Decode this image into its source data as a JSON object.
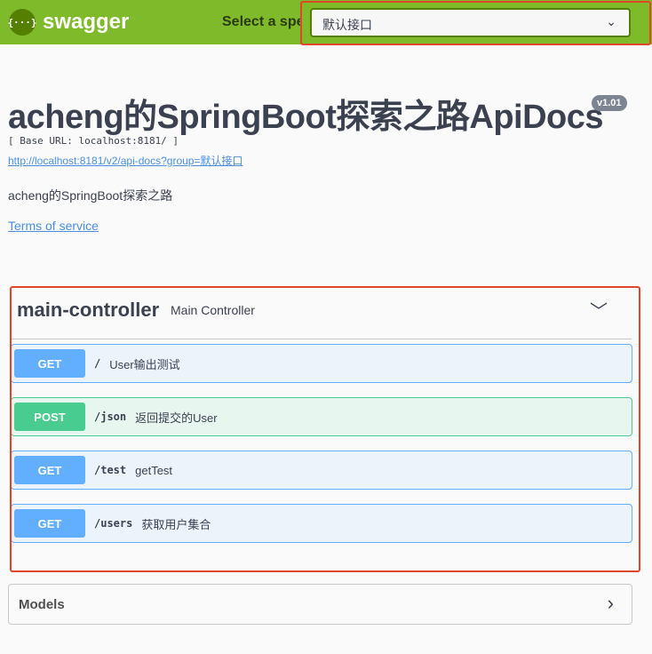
{
  "topbar": {
    "logo_glyph": "{···}",
    "brand": "swagger",
    "spec_label": "Select a spec",
    "spec_value": "默认接口"
  },
  "info": {
    "title": "acheng的SpringBoot探索之路ApiDocs",
    "version": "v1.01",
    "base_url": "[ Base URL: localhost:8181/ ]",
    "docs_link": "http://localhost:8181/v2/api-docs?group=默认接口",
    "description": "acheng的SpringBoot探索之路",
    "terms": "Terms of service"
  },
  "tag": {
    "name": "main-controller",
    "description": "Main Controller"
  },
  "operations": [
    {
      "method": "GET",
      "path": "/",
      "summary": "User输出测试"
    },
    {
      "method": "POST",
      "path": "/json",
      "summary": "返回提交的User"
    },
    {
      "method": "GET",
      "path": "/test",
      "summary": "getTest"
    },
    {
      "method": "GET",
      "path": "/users",
      "summary": "获取用户集合"
    }
  ],
  "models": {
    "label": "Models"
  },
  "colors": {
    "topbar": "#7fba2a",
    "get": "#61affe",
    "post": "#49cc90",
    "annotation": "#e0472a"
  }
}
